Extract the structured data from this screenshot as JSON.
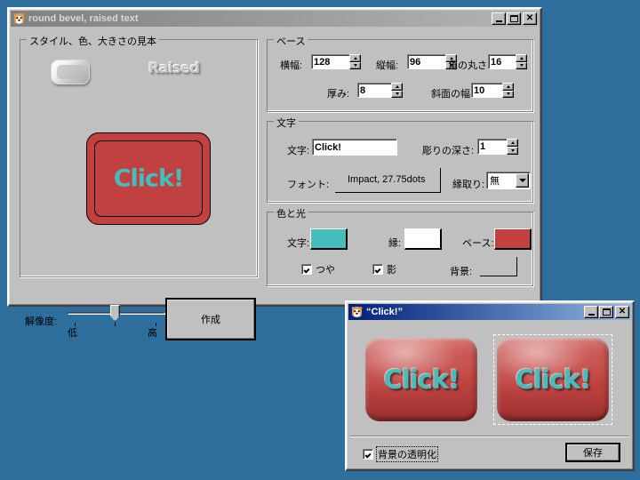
{
  "desktop": {
    "background_color": "#2e6f9e"
  },
  "main_window": {
    "title": "round bevel, raised text",
    "icon": "shiba-dog-icon",
    "state": "inactive",
    "controls": {
      "minimize": "_",
      "maximize": "□",
      "close": "✕"
    },
    "sample_group": {
      "legend": "スタイル、色、大きさの見本",
      "sample_text": "Raised",
      "preview_label": "Click!",
      "preview_base_color": "#c0413f",
      "preview_text_color": "#46bdbd"
    },
    "base_group": {
      "legend": "ベース",
      "fields": [
        {
          "label": "横幅:",
          "value": "128",
          "name": "width-spinner"
        },
        {
          "label": "縦幅:",
          "value": "96",
          "name": "height-spinner"
        },
        {
          "label": "角の丸さ:",
          "value": "16",
          "name": "corner-radius-spinner"
        },
        {
          "label": "厚み:",
          "value": "8",
          "name": "thickness-spinner"
        },
        {
          "label": "斜面の幅:",
          "value": "10",
          "name": "bevel-width-spinner"
        }
      ]
    },
    "text_group": {
      "legend": "文字",
      "text_label": "文字:",
      "text_value": "Click!",
      "depth_label": "彫りの深さ:",
      "depth_value": "1",
      "font_label": "フォント:",
      "font_value": "Impact, 27.75dots",
      "outline_label": "縁取り:",
      "outline_value": "無"
    },
    "color_group": {
      "legend": "色と光",
      "text_color_label": "文字:",
      "text_color": "#46bdbd",
      "edge_color_label": "縁:",
      "edge_color": "#ffffff",
      "base_color_label": "ベース:",
      "base_color": "#c0413f",
      "gloss_label": "つや",
      "gloss_checked": true,
      "shadow_label": "影",
      "shadow_checked": true,
      "background_label": "背景:",
      "background_color": "#c0c0c0"
    },
    "resolution": {
      "label": "解像度:",
      "low_label": "低",
      "high_label": "高",
      "value_percent": 48
    },
    "create_button": "作成"
  },
  "output_window": {
    "title": "“Click!”",
    "icon": "shiba-dog-icon",
    "state": "active",
    "controls": {
      "minimize": "_",
      "maximize": "□",
      "close": "✕"
    },
    "buttons": [
      {
        "label": "Click!",
        "name": "rendered-button-1",
        "selected": false
      },
      {
        "label": "Click!",
        "name": "rendered-button-2",
        "selected": true
      }
    ],
    "transparent_label": "背景の透明化",
    "transparent_checked": true,
    "save_button": "保存"
  }
}
